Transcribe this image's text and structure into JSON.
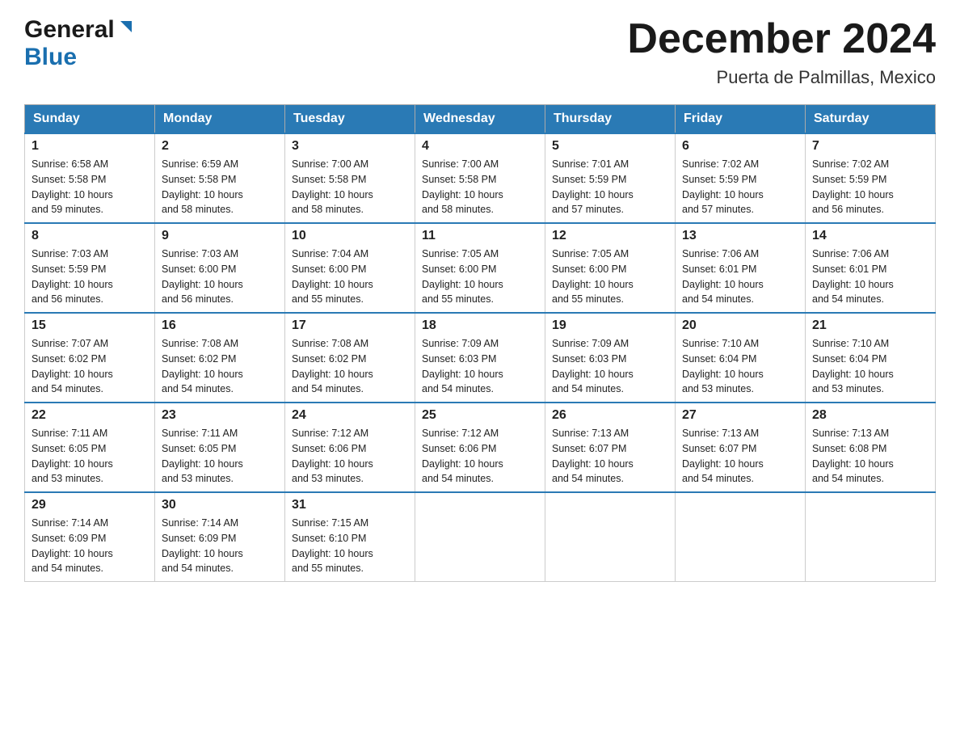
{
  "header": {
    "logo": {
      "general": "General",
      "blue": "Blue"
    },
    "title": "December 2024",
    "location": "Puerta de Palmillas, Mexico"
  },
  "days_of_week": [
    "Sunday",
    "Monday",
    "Tuesday",
    "Wednesday",
    "Thursday",
    "Friday",
    "Saturday"
  ],
  "weeks": [
    [
      {
        "day": "1",
        "sunrise": "6:58 AM",
        "sunset": "5:58 PM",
        "daylight": "10 hours and 59 minutes."
      },
      {
        "day": "2",
        "sunrise": "6:59 AM",
        "sunset": "5:58 PM",
        "daylight": "10 hours and 58 minutes."
      },
      {
        "day": "3",
        "sunrise": "7:00 AM",
        "sunset": "5:58 PM",
        "daylight": "10 hours and 58 minutes."
      },
      {
        "day": "4",
        "sunrise": "7:00 AM",
        "sunset": "5:58 PM",
        "daylight": "10 hours and 58 minutes."
      },
      {
        "day": "5",
        "sunrise": "7:01 AM",
        "sunset": "5:59 PM",
        "daylight": "10 hours and 57 minutes."
      },
      {
        "day": "6",
        "sunrise": "7:02 AM",
        "sunset": "5:59 PM",
        "daylight": "10 hours and 57 minutes."
      },
      {
        "day": "7",
        "sunrise": "7:02 AM",
        "sunset": "5:59 PM",
        "daylight": "10 hours and 56 minutes."
      }
    ],
    [
      {
        "day": "8",
        "sunrise": "7:03 AM",
        "sunset": "5:59 PM",
        "daylight": "10 hours and 56 minutes."
      },
      {
        "day": "9",
        "sunrise": "7:03 AM",
        "sunset": "6:00 PM",
        "daylight": "10 hours and 56 minutes."
      },
      {
        "day": "10",
        "sunrise": "7:04 AM",
        "sunset": "6:00 PM",
        "daylight": "10 hours and 55 minutes."
      },
      {
        "day": "11",
        "sunrise": "7:05 AM",
        "sunset": "6:00 PM",
        "daylight": "10 hours and 55 minutes."
      },
      {
        "day": "12",
        "sunrise": "7:05 AM",
        "sunset": "6:00 PM",
        "daylight": "10 hours and 55 minutes."
      },
      {
        "day": "13",
        "sunrise": "7:06 AM",
        "sunset": "6:01 PM",
        "daylight": "10 hours and 54 minutes."
      },
      {
        "day": "14",
        "sunrise": "7:06 AM",
        "sunset": "6:01 PM",
        "daylight": "10 hours and 54 minutes."
      }
    ],
    [
      {
        "day": "15",
        "sunrise": "7:07 AM",
        "sunset": "6:02 PM",
        "daylight": "10 hours and 54 minutes."
      },
      {
        "day": "16",
        "sunrise": "7:08 AM",
        "sunset": "6:02 PM",
        "daylight": "10 hours and 54 minutes."
      },
      {
        "day": "17",
        "sunrise": "7:08 AM",
        "sunset": "6:02 PM",
        "daylight": "10 hours and 54 minutes."
      },
      {
        "day": "18",
        "sunrise": "7:09 AM",
        "sunset": "6:03 PM",
        "daylight": "10 hours and 54 minutes."
      },
      {
        "day": "19",
        "sunrise": "7:09 AM",
        "sunset": "6:03 PM",
        "daylight": "10 hours and 54 minutes."
      },
      {
        "day": "20",
        "sunrise": "7:10 AM",
        "sunset": "6:04 PM",
        "daylight": "10 hours and 53 minutes."
      },
      {
        "day": "21",
        "sunrise": "7:10 AM",
        "sunset": "6:04 PM",
        "daylight": "10 hours and 53 minutes."
      }
    ],
    [
      {
        "day": "22",
        "sunrise": "7:11 AM",
        "sunset": "6:05 PM",
        "daylight": "10 hours and 53 minutes."
      },
      {
        "day": "23",
        "sunrise": "7:11 AM",
        "sunset": "6:05 PM",
        "daylight": "10 hours and 53 minutes."
      },
      {
        "day": "24",
        "sunrise": "7:12 AM",
        "sunset": "6:06 PM",
        "daylight": "10 hours and 53 minutes."
      },
      {
        "day": "25",
        "sunrise": "7:12 AM",
        "sunset": "6:06 PM",
        "daylight": "10 hours and 54 minutes."
      },
      {
        "day": "26",
        "sunrise": "7:13 AM",
        "sunset": "6:07 PM",
        "daylight": "10 hours and 54 minutes."
      },
      {
        "day": "27",
        "sunrise": "7:13 AM",
        "sunset": "6:07 PM",
        "daylight": "10 hours and 54 minutes."
      },
      {
        "day": "28",
        "sunrise": "7:13 AM",
        "sunset": "6:08 PM",
        "daylight": "10 hours and 54 minutes."
      }
    ],
    [
      {
        "day": "29",
        "sunrise": "7:14 AM",
        "sunset": "6:09 PM",
        "daylight": "10 hours and 54 minutes."
      },
      {
        "day": "30",
        "sunrise": "7:14 AM",
        "sunset": "6:09 PM",
        "daylight": "10 hours and 54 minutes."
      },
      {
        "day": "31",
        "sunrise": "7:15 AM",
        "sunset": "6:10 PM",
        "daylight": "10 hours and 55 minutes."
      },
      null,
      null,
      null,
      null
    ]
  ],
  "labels": {
    "sunrise": "Sunrise:",
    "sunset": "Sunset:",
    "daylight": "Daylight:"
  },
  "accent_color": "#2a7ab5"
}
